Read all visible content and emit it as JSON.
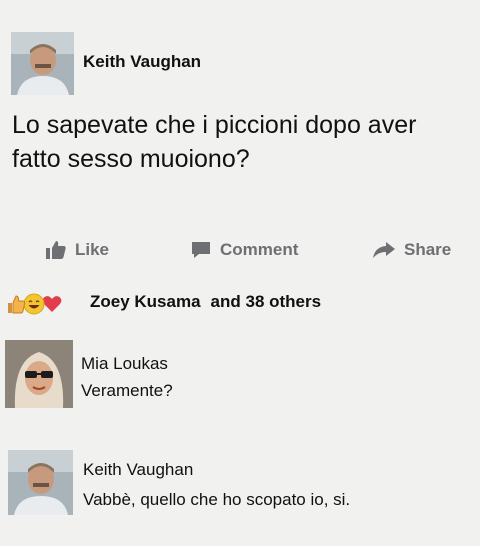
{
  "post": {
    "author": "Keith Vaughan",
    "text": "Lo sapevate che i piccioni dopo aver fatto sesso muoiono?"
  },
  "actions": {
    "like": "Like",
    "comment": "Comment",
    "share": "Share"
  },
  "reactions": {
    "icons": [
      "thumbs-up-icon",
      "laughing-face-icon",
      "heart-icon"
    ],
    "first_name": "Zoey Kusama",
    "others": "and 38 others"
  },
  "comments": [
    {
      "author": "Mia Loukas",
      "text": "Veramente?"
    },
    {
      "author": "Keith Vaughan",
      "text": "Vabbè, quello che ho scopato io, si."
    }
  ],
  "colors": {
    "background": "#f1f1ef",
    "action_gray": "#6d6f73",
    "like_blue": "#4d75bf",
    "heart_red": "#e23d4d",
    "haha_yellow": "#f4c530"
  }
}
